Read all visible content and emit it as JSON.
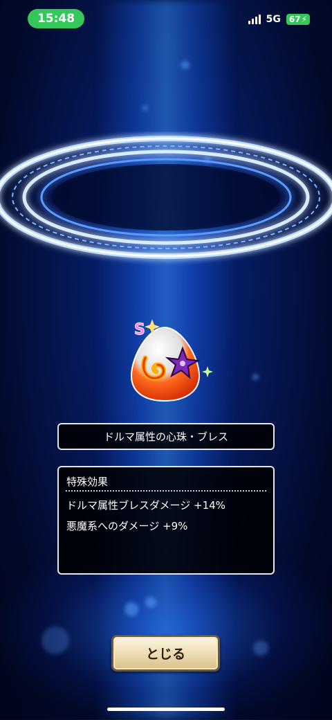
{
  "status_bar": {
    "time": "15:48",
    "network": "5G",
    "battery": "67",
    "colors": {
      "time_pill": "#34c759",
      "battery": "#34c759"
    }
  },
  "item": {
    "rank_badge": "S",
    "name": "ドルマ属性の心珠・ブレス",
    "icons": [
      "flame-swirl-icon",
      "dark-shuriken-icon",
      "sparkle-icon"
    ]
  },
  "effects": {
    "heading": "特殊効果",
    "lines": [
      "ドルマ属性ブレスダメージ +14%",
      "悪魔系へのダメージ +9%"
    ]
  },
  "close_button": {
    "label": "とじる"
  },
  "theme": {
    "accent": "#1e6bff",
    "panel_border": "#e8e8e8"
  }
}
